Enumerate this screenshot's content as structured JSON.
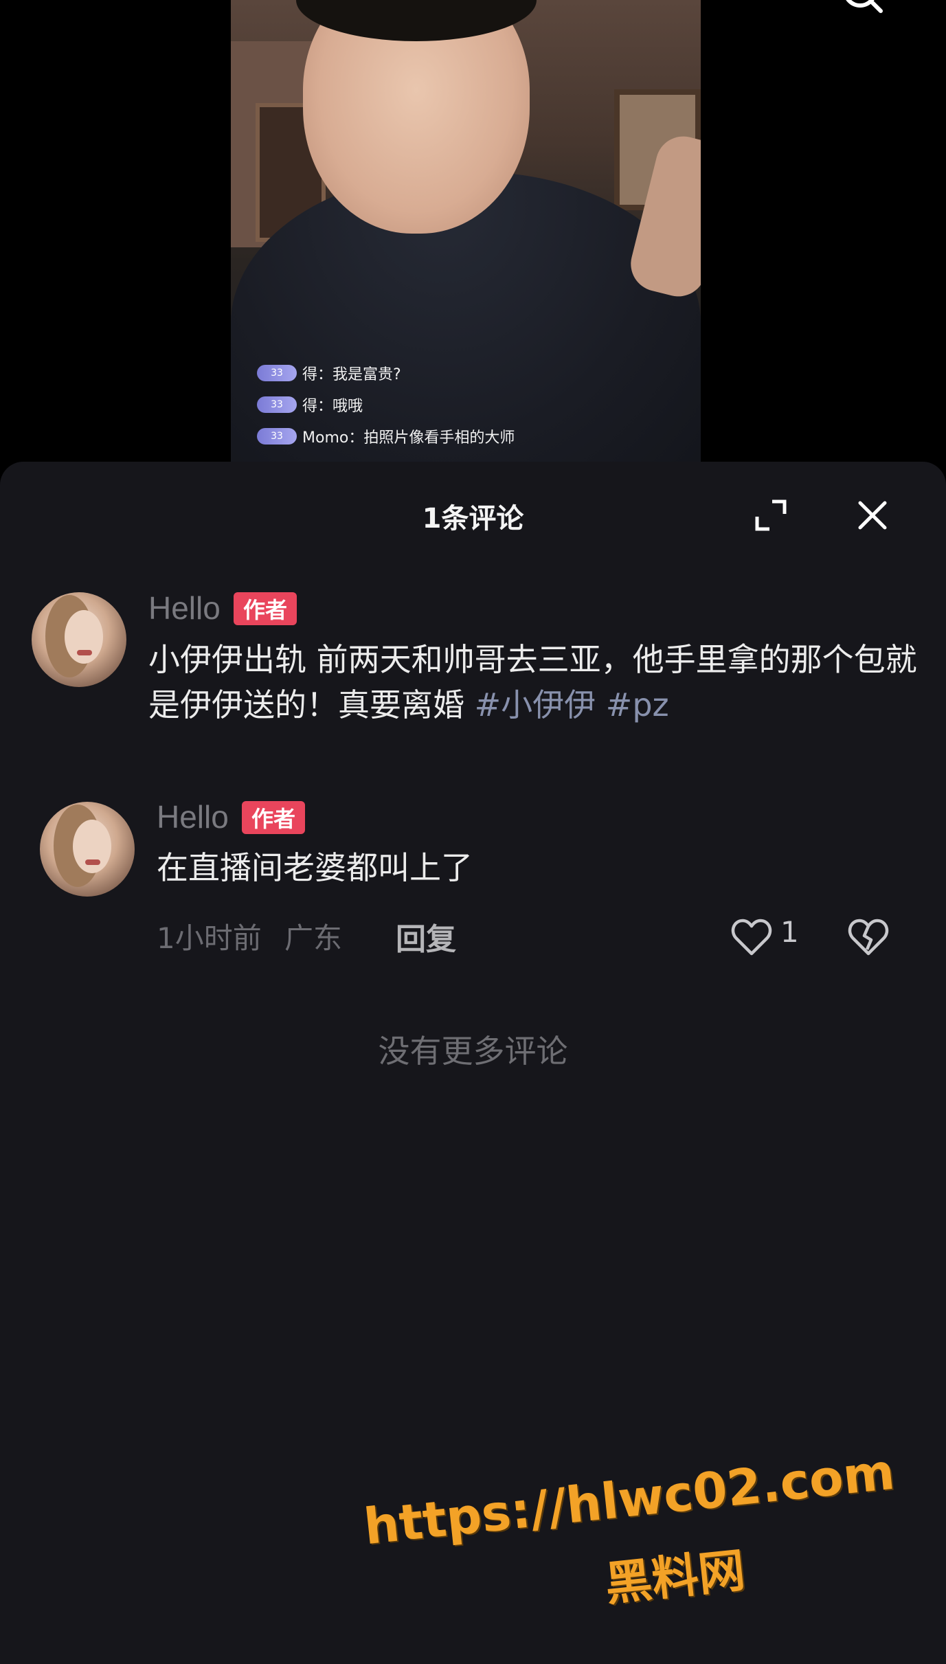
{
  "video": {
    "danmu": [
      {
        "level": "33",
        "text": "得：我是富贵?"
      },
      {
        "level": "33",
        "text": "得：哦哦"
      },
      {
        "level": "33",
        "text": "Momo：拍照片像看手相的大师"
      }
    ]
  },
  "sheet": {
    "title": "1条评论",
    "comments": [
      {
        "username": "Hello",
        "badge": "作者",
        "text": "小伊伊出轨 前两天和帅哥去三亚，他手里拿的那个包就是伊伊送的！真要离婚 ",
        "hashtags": [
          "#小伊伊",
          "#pz"
        ]
      },
      {
        "username": "Hello",
        "badge": "作者",
        "text": "在直播间老婆都叫上了",
        "time": "1小时前",
        "location": "广东",
        "reply_label": "回复",
        "like_count": "1"
      }
    ],
    "no_more": "没有更多评论"
  },
  "watermark": {
    "url": "https://hlwc02.com",
    "site_name": "黑料网"
  },
  "colors": {
    "sheet_bg": "#16161b",
    "badge": "#e9455c",
    "hashtag": "#8891ad",
    "watermark": "#f3a227"
  },
  "icons": [
    "search-icon",
    "expand-icon",
    "close-icon",
    "heart-icon",
    "broken-heart-icon"
  ]
}
